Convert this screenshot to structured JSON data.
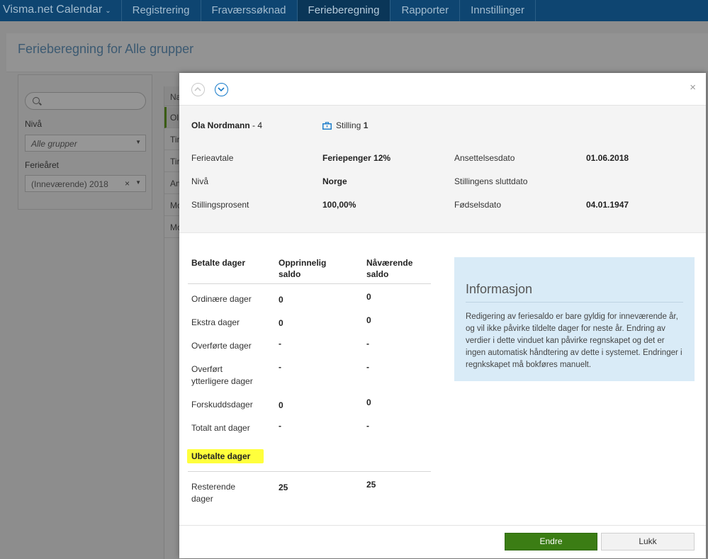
{
  "nav": {
    "brand": "Visma.net Calendar",
    "items": [
      "Registrering",
      "Fraværssøknad",
      "Ferieberegning",
      "Rapporter",
      "Innstillinger"
    ]
  },
  "page": {
    "title": "Ferieberegning for Alle grupper",
    "filter": {
      "level_label": "Nivå",
      "level_placeholder": "Alle grupper",
      "year_label": "Ferieåret",
      "year_value": "(Inneværende) 2018"
    },
    "list": {
      "header": "Na",
      "rows": [
        "Ol",
        "Tir",
        "Tir",
        "An",
        "Mo",
        "Mo"
      ]
    }
  },
  "modal": {
    "employee": {
      "name": "Ola Nordmann",
      "suffix": " - 4"
    },
    "position": {
      "label": "Stilling ",
      "number": "1"
    },
    "details": {
      "ferieavtale_label": "Ferieavtale",
      "ferieavtale_value": "Feriepenger 12%",
      "niva_label": "Nivå",
      "niva_value": "Norge",
      "stillingsprosent_label": "Stillingsprosent",
      "stillingsprosent_value": "100,00%",
      "ansettelsesdato_label": "Ansettelsesdato",
      "ansettelsesdato_value": "01.06.2018",
      "sluttdato_label": "Stillingens sluttdato",
      "fodselsdato_label": "Fødselsdato",
      "fodselsdato_value": "04.01.1947"
    },
    "table": {
      "col_paid": "Betalte dager",
      "col_original": "Opprinnelig\nsaldo",
      "col_current": "Nåværende\nsaldo",
      "rows": [
        {
          "label": "Ordinære dager",
          "original": "0",
          "current": "0"
        },
        {
          "label": "Ekstra dager",
          "original": "0",
          "current": "0"
        },
        {
          "label": "Overførte dager",
          "original": "-",
          "current": "-"
        },
        {
          "label": "Overført\nytterligere dager",
          "original": "-",
          "current": "-"
        },
        {
          "label": "Forskuddsdager",
          "original": "0",
          "current": "0"
        },
        {
          "label": "Totalt ant dager",
          "original": "-",
          "current": "-"
        }
      ],
      "unpaid_title": "Ubetalte dager",
      "remaining": {
        "label": "Resterende\ndager",
        "original": "25",
        "current": "25"
      }
    },
    "info": {
      "title": "Informasjon",
      "text": "Redigering av feriesaldo er bare gyldig for inneværende år, og vil ikke påvirke tildelte dager for neste år. Endring av verdier i dette vinduet kan påvirke regnskapet og det er ingen automatisk håndtering av dette i systemet. Endringer i regnkskapet må bokføres manuelt."
    },
    "buttons": {
      "edit": "Endre",
      "close": "Lukk"
    }
  },
  "colors": {
    "nav_bg": "#0e4571",
    "primary_button": "#3b7d14",
    "info_bg": "#d9ebf7",
    "highlight": "#ffff3c"
  }
}
